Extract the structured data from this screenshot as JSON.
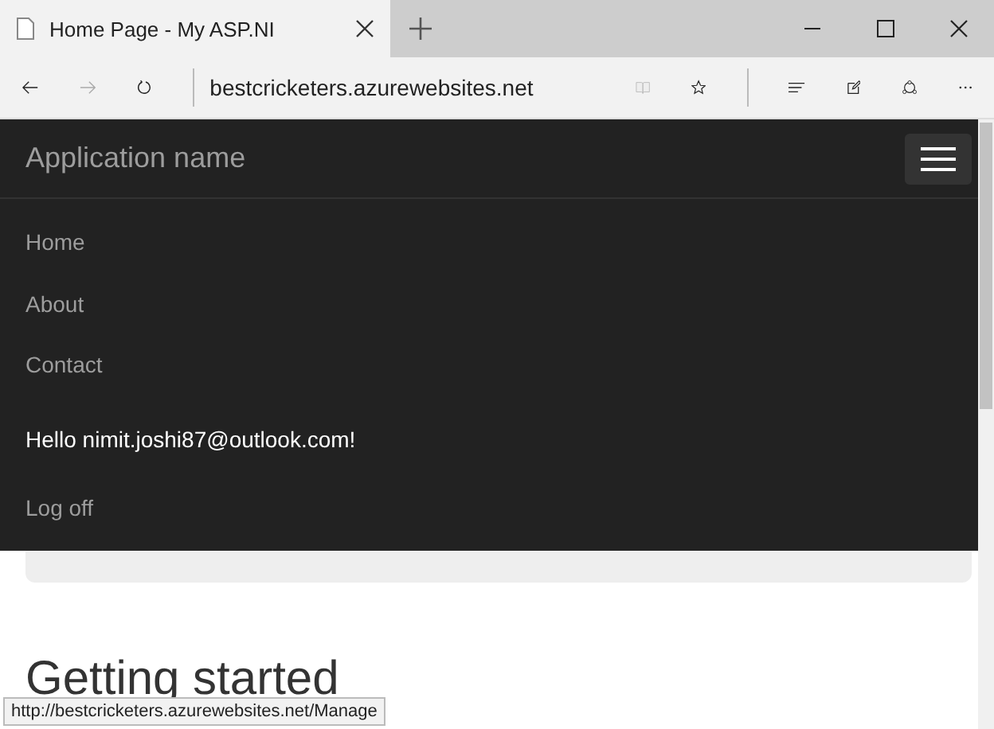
{
  "browser": {
    "tab_title": "Home Page - My ASP.NI",
    "address": "bestcricketers.azurewebsites.net"
  },
  "navbar": {
    "brand": "Application name",
    "expanded": true,
    "links": [
      {
        "label": "Home"
      },
      {
        "label": "About"
      },
      {
        "label": "Contact"
      }
    ],
    "greeting": "Hello nimit.joshi87@outlook.com!",
    "logoff": "Log off"
  },
  "content": {
    "heading": "Getting started"
  },
  "status_url": "http://bestcricketers.azurewebsites.net/Manage"
}
